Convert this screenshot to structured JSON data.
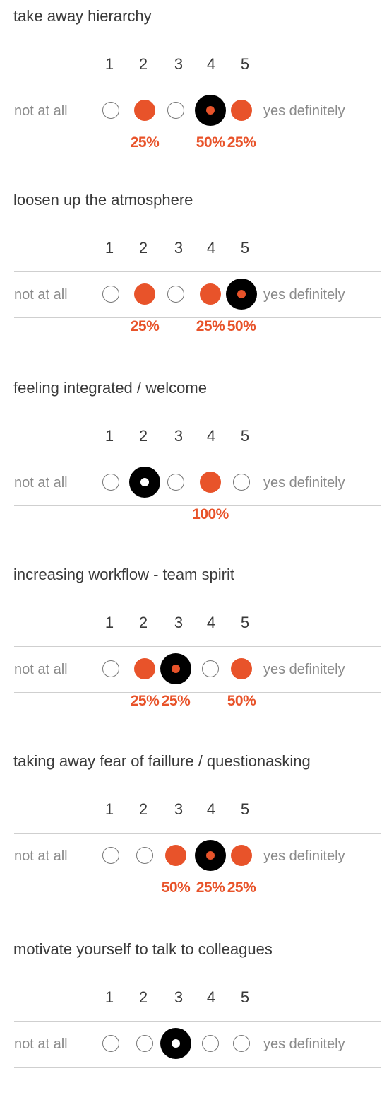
{
  "scale": {
    "numbers": [
      "1",
      "2",
      "3",
      "4",
      "5"
    ],
    "left_label": "not at all",
    "right_label": "yes definitely"
  },
  "colors": {
    "accent": "#e8532a",
    "selected": "#000000",
    "text": "#3a3a3a",
    "muted": "#8a8a8a"
  },
  "questions": [
    {
      "title": "take away hierarchy",
      "options": [
        "empty",
        "orange",
        "empty",
        "selected",
        "orange"
      ],
      "selected_dot": "orange",
      "percentages": [
        "",
        "25%",
        "",
        "50%",
        "25%"
      ]
    },
    {
      "title": "loosen up the atmosphere",
      "options": [
        "empty",
        "orange",
        "empty",
        "orange",
        "selected"
      ],
      "selected_dot": "orange",
      "percentages": [
        "",
        "25%",
        "",
        "25%",
        "50%"
      ]
    },
    {
      "title": "feeling integrated / welcome",
      "options": [
        "empty",
        "selected",
        "empty",
        "orange",
        "empty"
      ],
      "selected_dot": "white",
      "percentages": [
        "",
        "",
        "",
        "100%",
        ""
      ]
    },
    {
      "title": "increasing workflow - team spirit",
      "options": [
        "empty",
        "orange",
        "selected",
        "empty",
        "orange"
      ],
      "selected_dot": "orange",
      "percentages": [
        "",
        "25%",
        "25%",
        "",
        "50%"
      ]
    },
    {
      "title": "taking away fear of faillure / questionasking",
      "options": [
        "empty",
        "empty",
        "orange",
        "selected",
        "orange"
      ],
      "selected_dot": "orange",
      "percentages": [
        "",
        "",
        "50%",
        "25%",
        "25%"
      ]
    },
    {
      "title": "motivate yourself to talk to colleagues",
      "options": [
        "empty",
        "empty",
        "selected",
        "empty",
        "empty"
      ],
      "selected_dot": "white",
      "percentages": [
        "",
        "",
        "",
        "",
        ""
      ]
    }
  ]
}
